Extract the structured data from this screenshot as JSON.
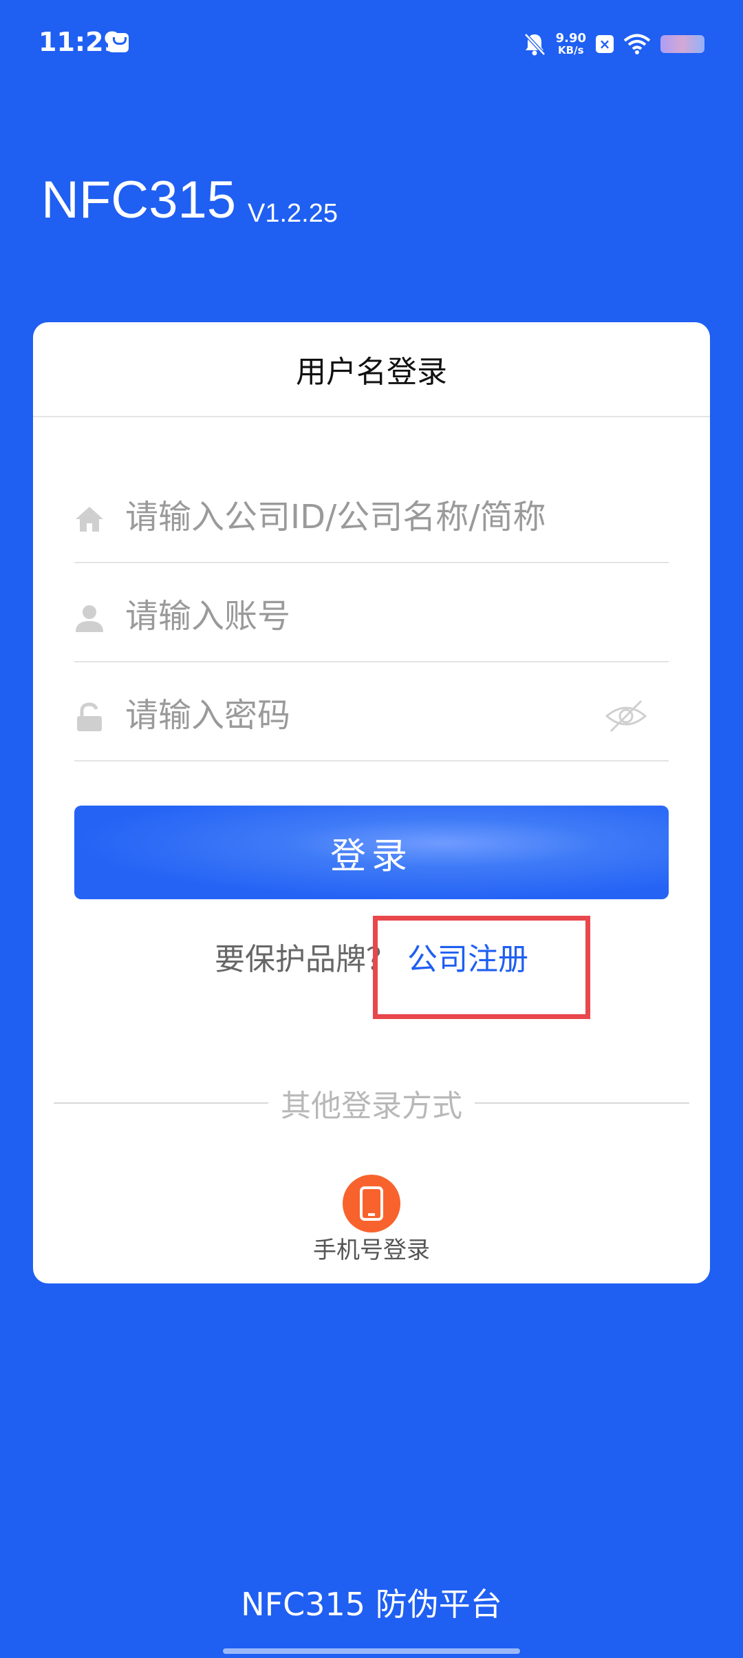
{
  "status_bar": {
    "time": "11:29",
    "net_speed": "9.90",
    "net_unit": "KB/s"
  },
  "app": {
    "title": "NFC315",
    "version": "V1.2.25"
  },
  "login_card": {
    "header": "用户名登录",
    "company_field": {
      "placeholder": "请输入公司ID/公司名称/简称",
      "value": ""
    },
    "account_field": {
      "placeholder": "请输入账号",
      "value": ""
    },
    "password_field": {
      "placeholder": "请输入密码",
      "value": ""
    },
    "login_button": "登录",
    "register_prompt": "要保护品牌？",
    "register_link": "公司注册",
    "other_methods": "其他登录方式",
    "phone_login": "手机号登录"
  },
  "footer": "NFC315 防伪平台",
  "colors": {
    "background": "#1f5ff2",
    "link": "#1f5ff2",
    "highlight": "#e8474c",
    "phone_icon": "#f8632d"
  }
}
